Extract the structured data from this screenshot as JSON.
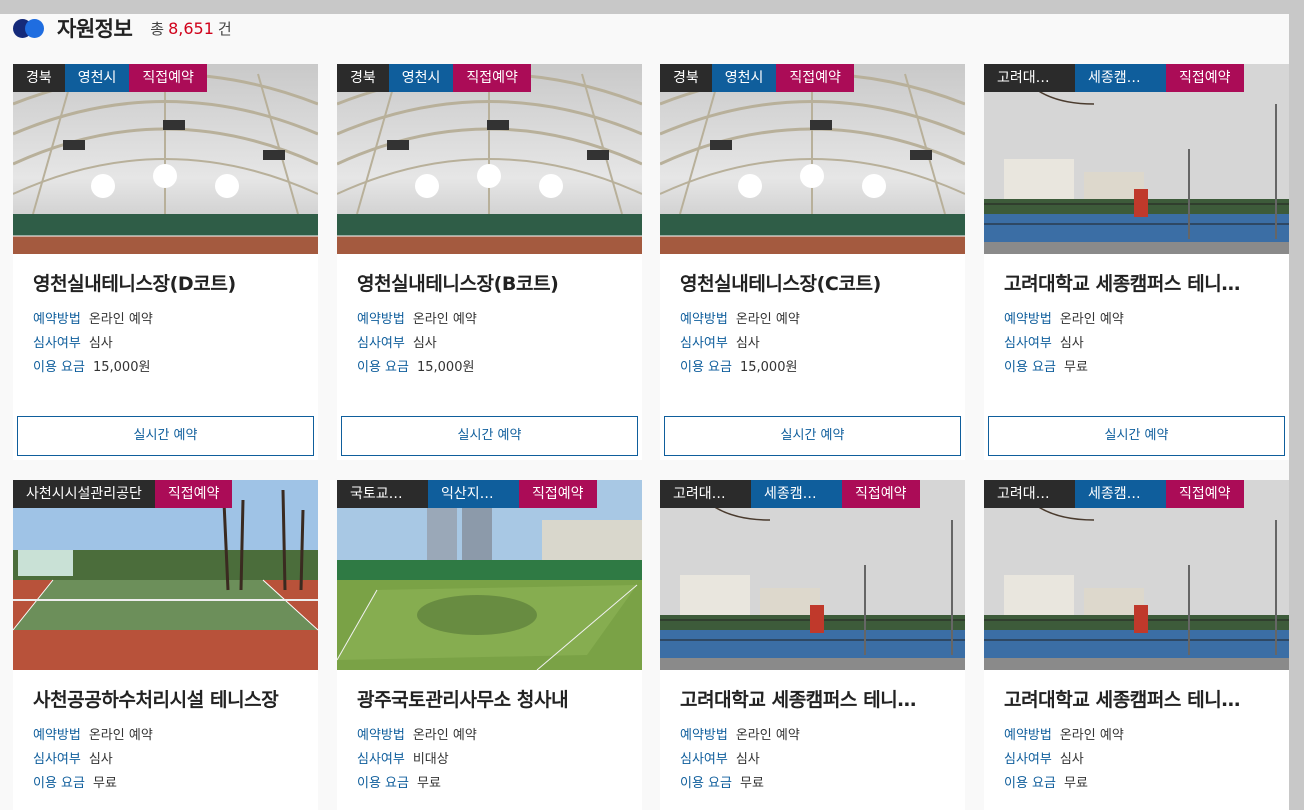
{
  "header": {
    "title": "자원정보",
    "count_prefix": "총",
    "count_value": "8,651",
    "count_suffix": "건"
  },
  "labels": {
    "method": "예약방법",
    "review": "심사여부",
    "fee": "이용 요금",
    "button": "실시간 예약"
  },
  "cards": [
    {
      "tags": [
        "경북",
        "영천시",
        "직접예약"
      ],
      "name": "영천실내테니스장(D코트)",
      "method": "온라인 예약",
      "review": "심사",
      "fee": "15,000원",
      "photo": "indoor"
    },
    {
      "tags": [
        "경북",
        "영천시",
        "직접예약"
      ],
      "name": "영천실내테니스장(B코트)",
      "method": "온라인 예약",
      "review": "심사",
      "fee": "15,000원",
      "photo": "indoor"
    },
    {
      "tags": [
        "경북",
        "영천시",
        "직접예약"
      ],
      "name": "영천실내테니스장(C코트)",
      "method": "온라인 예약",
      "review": "심사",
      "fee": "15,000원",
      "photo": "indoor"
    },
    {
      "tags": [
        "고려대…",
        "세종캠…",
        "직접예약"
      ],
      "name": "고려대학교 세종캠퍼스 테니…",
      "method": "온라인 예약",
      "review": "심사",
      "fee": "무료",
      "photo": "campus"
    },
    {
      "tags": [
        "사천시시설관리공단",
        "직접예약"
      ],
      "name": "사천공공하수처리시설 테니스장",
      "method": "온라인 예약",
      "review": "심사",
      "fee": "무료",
      "photo": "clay"
    },
    {
      "tags": [
        "국토교…",
        "익산지…",
        "직접예약"
      ],
      "name": "광주국토관리사무소 청사내",
      "method": "온라인 예약",
      "review": "비대상",
      "fee": "무료",
      "photo": "grass"
    },
    {
      "tags": [
        "고려대…",
        "세종캠…",
        "직접예약"
      ],
      "name": "고려대학교 세종캠퍼스 테니…",
      "method": "온라인 예약",
      "review": "심사",
      "fee": "무료",
      "photo": "campus"
    },
    {
      "tags": [
        "고려대…",
        "세종캠…",
        "직접예약"
      ],
      "name": "고려대학교 세종캠퍼스 테니…",
      "method": "온라인 예약",
      "review": "심사",
      "fee": "무료",
      "photo": "campus"
    }
  ]
}
